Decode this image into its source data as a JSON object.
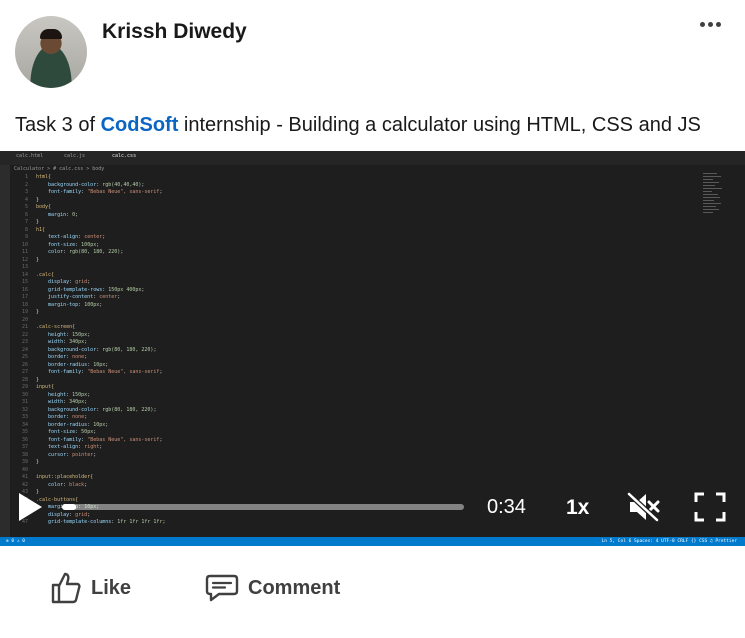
{
  "post": {
    "author": "Krissh Diwedy",
    "text_before": "Task 3 of ",
    "mention": "CodSoft",
    "text_after": " internship - Building a calculator using HTML, CSS and JS"
  },
  "editor": {
    "tabs": [
      "calc.html",
      "calc.js",
      "calc.css"
    ],
    "breadcrumb": "Calculator > # calc.css > body",
    "lines": [
      {
        "n": "1",
        "segs": [
          [
            "sel",
            "html{"
          ]
        ]
      },
      {
        "n": "2",
        "segs": [
          [
            "prop",
            "    background-color"
          ],
          [
            "punc",
            ": "
          ],
          [
            "num",
            "rgb(40,40,40)"
          ],
          [
            "punc",
            ";"
          ]
        ]
      },
      {
        "n": "3",
        "segs": [
          [
            "prop",
            "    font-family"
          ],
          [
            "punc",
            ": "
          ],
          [
            "val",
            "\"Bebas Neue\", sans-serif"
          ],
          [
            "punc",
            ";"
          ]
        ]
      },
      {
        "n": "4",
        "segs": [
          [
            "punc",
            "}"
          ]
        ]
      },
      {
        "n": "5",
        "segs": [
          [
            "sel",
            "body{"
          ]
        ]
      },
      {
        "n": "6",
        "segs": [
          [
            "prop",
            "    margin"
          ],
          [
            "punc",
            ": "
          ],
          [
            "num",
            "0"
          ],
          [
            "punc",
            ";"
          ]
        ]
      },
      {
        "n": "7",
        "segs": [
          [
            "punc",
            "}"
          ]
        ]
      },
      {
        "n": "8",
        "segs": [
          [
            "sel",
            "h1{"
          ]
        ]
      },
      {
        "n": "9",
        "segs": [
          [
            "prop",
            "    text-align"
          ],
          [
            "punc",
            ": "
          ],
          [
            "val",
            "center"
          ],
          [
            "punc",
            ";"
          ]
        ]
      },
      {
        "n": "10",
        "segs": [
          [
            "prop",
            "    font-size"
          ],
          [
            "punc",
            ": "
          ],
          [
            "num",
            "100px"
          ],
          [
            "punc",
            ";"
          ]
        ]
      },
      {
        "n": "11",
        "segs": [
          [
            "prop",
            "    color"
          ],
          [
            "punc",
            ": "
          ],
          [
            "num",
            "rgb(80, 180, 220)"
          ],
          [
            "punc",
            ";"
          ]
        ]
      },
      {
        "n": "12",
        "segs": [
          [
            "punc",
            "}"
          ]
        ]
      },
      {
        "n": "13",
        "segs": []
      },
      {
        "n": "14",
        "segs": [
          [
            "sel",
            ".calc{"
          ]
        ]
      },
      {
        "n": "15",
        "segs": [
          [
            "prop",
            "    display"
          ],
          [
            "punc",
            ": "
          ],
          [
            "val",
            "grid"
          ],
          [
            "punc",
            ";"
          ]
        ]
      },
      {
        "n": "16",
        "segs": [
          [
            "prop",
            "    grid-template-rows"
          ],
          [
            "punc",
            ": "
          ],
          [
            "num",
            "150px 400px"
          ],
          [
            "punc",
            ";"
          ]
        ]
      },
      {
        "n": "17",
        "segs": [
          [
            "prop",
            "    justify-content"
          ],
          [
            "punc",
            ": "
          ],
          [
            "val",
            "center"
          ],
          [
            "punc",
            ";"
          ]
        ]
      },
      {
        "n": "18",
        "segs": [
          [
            "prop",
            "    margin-top"
          ],
          [
            "punc",
            ": "
          ],
          [
            "num",
            "100px"
          ],
          [
            "punc",
            ";"
          ]
        ]
      },
      {
        "n": "19",
        "segs": [
          [
            "punc",
            "}"
          ]
        ]
      },
      {
        "n": "20",
        "segs": []
      },
      {
        "n": "21",
        "segs": [
          [
            "sel",
            ".calc-screen{"
          ]
        ]
      },
      {
        "n": "22",
        "segs": [
          [
            "prop",
            "    height"
          ],
          [
            "punc",
            ": "
          ],
          [
            "num",
            "150px"
          ],
          [
            "punc",
            ";"
          ]
        ]
      },
      {
        "n": "23",
        "segs": [
          [
            "prop",
            "    width"
          ],
          [
            "punc",
            ": "
          ],
          [
            "num",
            "340px"
          ],
          [
            "punc",
            ";"
          ]
        ]
      },
      {
        "n": "24",
        "segs": [
          [
            "prop",
            "    background-color"
          ],
          [
            "punc",
            ": "
          ],
          [
            "num",
            "rgb(80, 180, 220)"
          ],
          [
            "punc",
            ";"
          ]
        ]
      },
      {
        "n": "25",
        "segs": [
          [
            "prop",
            "    border"
          ],
          [
            "punc",
            ": "
          ],
          [
            "val",
            "none"
          ],
          [
            "punc",
            ";"
          ]
        ]
      },
      {
        "n": "26",
        "segs": [
          [
            "prop",
            "    border-radius"
          ],
          [
            "punc",
            ": "
          ],
          [
            "num",
            "10px"
          ],
          [
            "punc",
            ";"
          ]
        ]
      },
      {
        "n": "27",
        "segs": [
          [
            "prop",
            "    font-family"
          ],
          [
            "punc",
            ": "
          ],
          [
            "val",
            "\"Bebas Neue\", sans-serif"
          ],
          [
            "punc",
            ";"
          ]
        ]
      },
      {
        "n": "28",
        "segs": [
          [
            "punc",
            "}"
          ]
        ]
      },
      {
        "n": "29",
        "segs": [
          [
            "sel",
            "input{"
          ]
        ]
      },
      {
        "n": "30",
        "segs": [
          [
            "prop",
            "    height"
          ],
          [
            "punc",
            ": "
          ],
          [
            "num",
            "150px"
          ],
          [
            "punc",
            ";"
          ]
        ]
      },
      {
        "n": "31",
        "segs": [
          [
            "prop",
            "    width"
          ],
          [
            "punc",
            ": "
          ],
          [
            "num",
            "340px"
          ],
          [
            "punc",
            ";"
          ]
        ]
      },
      {
        "n": "32",
        "segs": [
          [
            "prop",
            "    background-color"
          ],
          [
            "punc",
            ": "
          ],
          [
            "num",
            "rgb(80, 180, 220)"
          ],
          [
            "punc",
            ";"
          ]
        ]
      },
      {
        "n": "33",
        "segs": [
          [
            "prop",
            "    border"
          ],
          [
            "punc",
            ": "
          ],
          [
            "val",
            "none"
          ],
          [
            "punc",
            ";"
          ]
        ]
      },
      {
        "n": "34",
        "segs": [
          [
            "prop",
            "    border-radius"
          ],
          [
            "punc",
            ": "
          ],
          [
            "num",
            "10px"
          ],
          [
            "punc",
            ";"
          ]
        ]
      },
      {
        "n": "35",
        "segs": [
          [
            "prop",
            "    font-size"
          ],
          [
            "punc",
            ": "
          ],
          [
            "num",
            "50px"
          ],
          [
            "punc",
            ";"
          ]
        ]
      },
      {
        "n": "36",
        "segs": [
          [
            "prop",
            "    font-family"
          ],
          [
            "punc",
            ": "
          ],
          [
            "val",
            "\"Bebas Neue\", sans-serif"
          ],
          [
            "punc",
            ";"
          ]
        ]
      },
      {
        "n": "37",
        "segs": [
          [
            "prop",
            "    text-align"
          ],
          [
            "punc",
            ": "
          ],
          [
            "val",
            "right"
          ],
          [
            "punc",
            ";"
          ]
        ]
      },
      {
        "n": "38",
        "segs": [
          [
            "prop",
            "    cursor"
          ],
          [
            "punc",
            ": "
          ],
          [
            "val",
            "pointer"
          ],
          [
            "punc",
            ";"
          ]
        ]
      },
      {
        "n": "39",
        "segs": [
          [
            "punc",
            "}"
          ]
        ]
      },
      {
        "n": "40",
        "segs": []
      },
      {
        "n": "41",
        "segs": [
          [
            "sel",
            "input::placeholder{"
          ]
        ]
      },
      {
        "n": "42",
        "segs": [
          [
            "prop",
            "    color"
          ],
          [
            "punc",
            ": "
          ],
          [
            "val",
            "black"
          ],
          [
            "punc",
            ";"
          ]
        ]
      },
      {
        "n": "43",
        "segs": [
          [
            "punc",
            "}"
          ]
        ]
      },
      {
        "n": "44",
        "segs": [
          [
            "sel",
            ".calc-buttons{"
          ]
        ]
      },
      {
        "n": "45",
        "segs": [
          [
            "prop",
            "    margin-top"
          ],
          [
            "punc",
            ": "
          ],
          [
            "num",
            "10px"
          ],
          [
            "punc",
            ";"
          ]
        ]
      },
      {
        "n": "46",
        "segs": [
          [
            "prop",
            "    display"
          ],
          [
            "punc",
            ": "
          ],
          [
            "val",
            "grid"
          ],
          [
            "punc",
            ";"
          ]
        ]
      },
      {
        "n": "47",
        "segs": [
          [
            "prop",
            "    grid-template-columns"
          ],
          [
            "punc",
            ": "
          ],
          [
            "num",
            "1fr 1fr 1fr 1fr"
          ],
          [
            "punc",
            ";"
          ]
        ]
      }
    ],
    "status_left": "⊗ 0  ⚠ 0",
    "status_right": "Ln 5, Col 6   Spaces: 4   UTF-8   CRLF   {} CSS   ♫ Prettier"
  },
  "video": {
    "time": "0:34",
    "speed": "1x",
    "progress_fraction": 0.035,
    "muted": true
  },
  "actions": {
    "like_label": "Like",
    "comment_label": "Comment"
  },
  "colors": {
    "mention": "#0a66c2",
    "editor_bg": "#1e1e1e",
    "statusbar": "#007acc"
  },
  "icons": [
    "more-icon",
    "play-icon",
    "mute-icon",
    "fullscreen-icon",
    "like-icon",
    "comment-icon"
  ]
}
